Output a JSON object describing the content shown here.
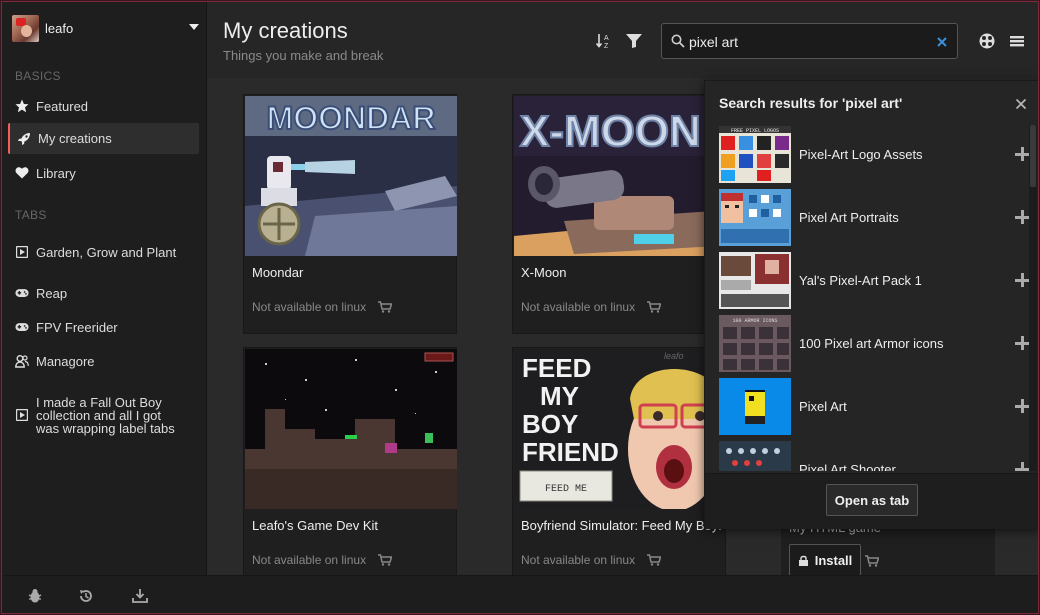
{
  "user": {
    "name": "leafo"
  },
  "sidebar": {
    "basics_title": "BASICS",
    "basics": [
      {
        "label": "Featured",
        "icon": "star-icon"
      },
      {
        "label": "My creations",
        "icon": "rocket-icon",
        "active": true
      },
      {
        "label": "Library",
        "icon": "heart-icon"
      }
    ],
    "tabs_title": "TABS",
    "tabs": [
      {
        "label": "Garden, Grow and Plant",
        "icon": "game-tab-icon"
      },
      {
        "label": "Reap",
        "icon": "gamepad-icon"
      },
      {
        "label": "FPV Freerider",
        "icon": "gamepad-icon"
      },
      {
        "label": "Managore",
        "icon": "users-icon"
      },
      {
        "label": "I made a Fall Out Boy collection and all I got was wrapping label tabs",
        "icon": "game-tab-icon"
      }
    ]
  },
  "header": {
    "title": "My creations",
    "subtitle": "Things you make and break"
  },
  "search": {
    "value": "pixel art",
    "placeholder": ""
  },
  "games": [
    {
      "title": "Moondar",
      "status": "Not available on linux"
    },
    {
      "title": "X-Moon",
      "status": "Not available on linux"
    },
    {
      "title": "Leafo's Game Dev Kit",
      "status": "Not available on linux"
    },
    {
      "title": "Boyfriend Simulator: Feed My Boyfriend",
      "status": "Not available on linux"
    }
  ],
  "partial_card": {
    "title": "My HTML game",
    "install_label": "Install"
  },
  "popup": {
    "title": "Search results for 'pixel art'",
    "results": [
      {
        "title": "Pixel-Art Logo Assets"
      },
      {
        "title": "Pixel Art Portraits"
      },
      {
        "title": "Yal's Pixel-Art Pack 1"
      },
      {
        "title": "100 Pixel art Armor icons"
      },
      {
        "title": "Pixel Art"
      },
      {
        "title": "Pixel Art Shooter"
      }
    ],
    "open_tab_label": "Open as tab"
  },
  "thumb_text": {
    "moondar": "MOONDAR",
    "xmoon": "X-MOON",
    "feed": [
      "FEED",
      "MY",
      "BOY",
      "FRIEND"
    ],
    "feed_btn": "FEED ME",
    "feed_sig": "leafo",
    "logo_banner": "FREE PIXEL LOGOS",
    "armor_banner": "100 ARMOR ICONS"
  },
  "colors": {
    "accent": "#fa5c5c",
    "background": "#232323",
    "sidebar": "#1e1e1e"
  }
}
